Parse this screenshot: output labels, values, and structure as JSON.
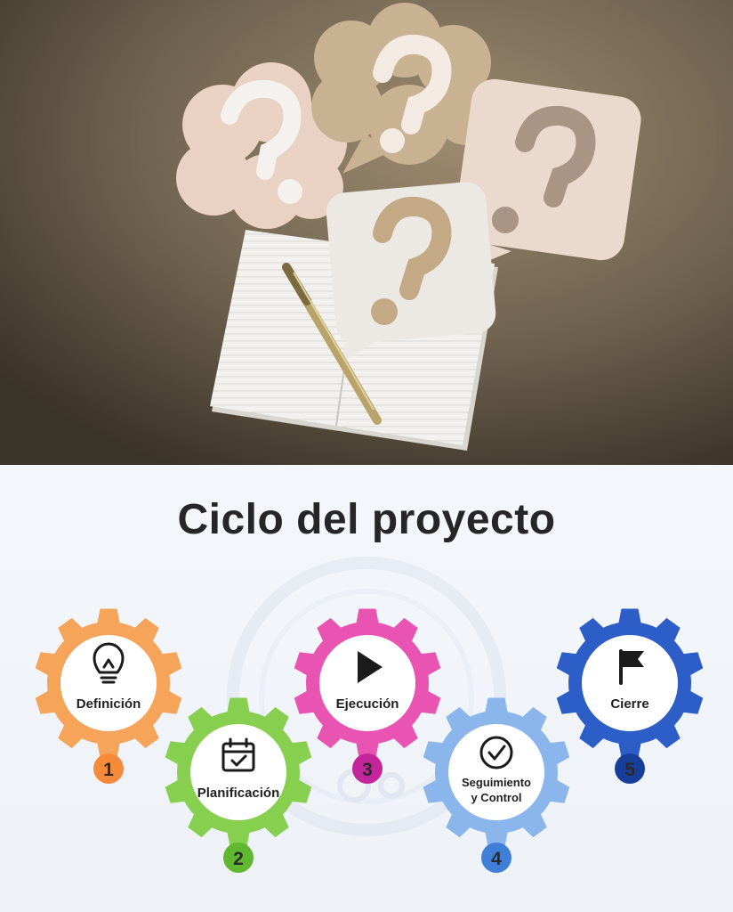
{
  "title": "Ciclo del proyecto",
  "stages": [
    {
      "number": "1",
      "label": "Definición",
      "icon": "lightbulb-icon",
      "color": "#f7a45b",
      "badge": "#f58a3a"
    },
    {
      "number": "2",
      "label": "Planificación",
      "icon": "calendar-icon",
      "color": "#86cf4f",
      "badge": "#5fb82e"
    },
    {
      "number": "3",
      "label": "Ejecución",
      "icon": "play-icon",
      "color": "#e954b3",
      "badge": "#c4259a"
    },
    {
      "number": "4",
      "label_lines": [
        "Seguimiento",
        "y Control"
      ],
      "icon": "check-circle-icon",
      "color": "#8bb6ec",
      "badge": "#3f7fd8"
    },
    {
      "number": "5",
      "label": "Cierre",
      "icon": "flag-icon",
      "color": "#2d5ec7",
      "badge": "#173f9a"
    }
  ]
}
